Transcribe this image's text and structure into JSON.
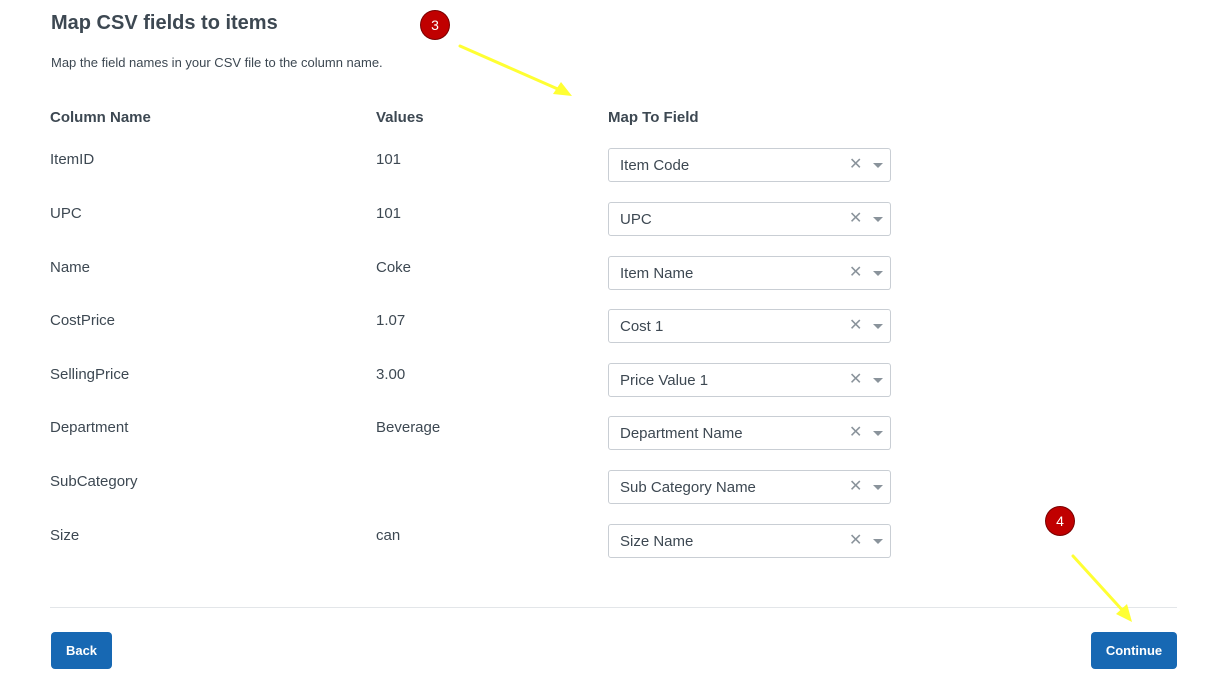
{
  "page": {
    "title": "Map CSV fields to items",
    "subtitle": "Map the field names in your CSV file to the column name."
  },
  "table": {
    "headers": {
      "column_name": "Column Name",
      "values": "Values",
      "map_to_field": "Map To Field"
    },
    "rows": [
      {
        "column": "ItemID",
        "value": "101",
        "field": "Item Code"
      },
      {
        "column": "UPC",
        "value": "101",
        "field": "UPC"
      },
      {
        "column": "Name",
        "value": "Coke",
        "field": "Item Name"
      },
      {
        "column": "CostPrice",
        "value": "1.07",
        "field": "Cost 1"
      },
      {
        "column": "SellingPrice",
        "value": "3.00",
        "field": "Price Value 1"
      },
      {
        "column": "Department",
        "value": "Beverage",
        "field": "Department Name"
      },
      {
        "column": "SubCategory",
        "value": "",
        "field": "Sub Category Name"
      },
      {
        "column": "Size",
        "value": "can",
        "field": "Size Name"
      }
    ]
  },
  "select_icons": {
    "clear": "close-icon",
    "caret": "chevron-down-icon"
  },
  "buttons": {
    "back": "Back",
    "continue": "Continue"
  },
  "annotations": {
    "step3": "3",
    "step4": "4"
  },
  "colors": {
    "primary_button": "#1768b3",
    "badge": "#c00000",
    "arrow": "#ffff33"
  }
}
